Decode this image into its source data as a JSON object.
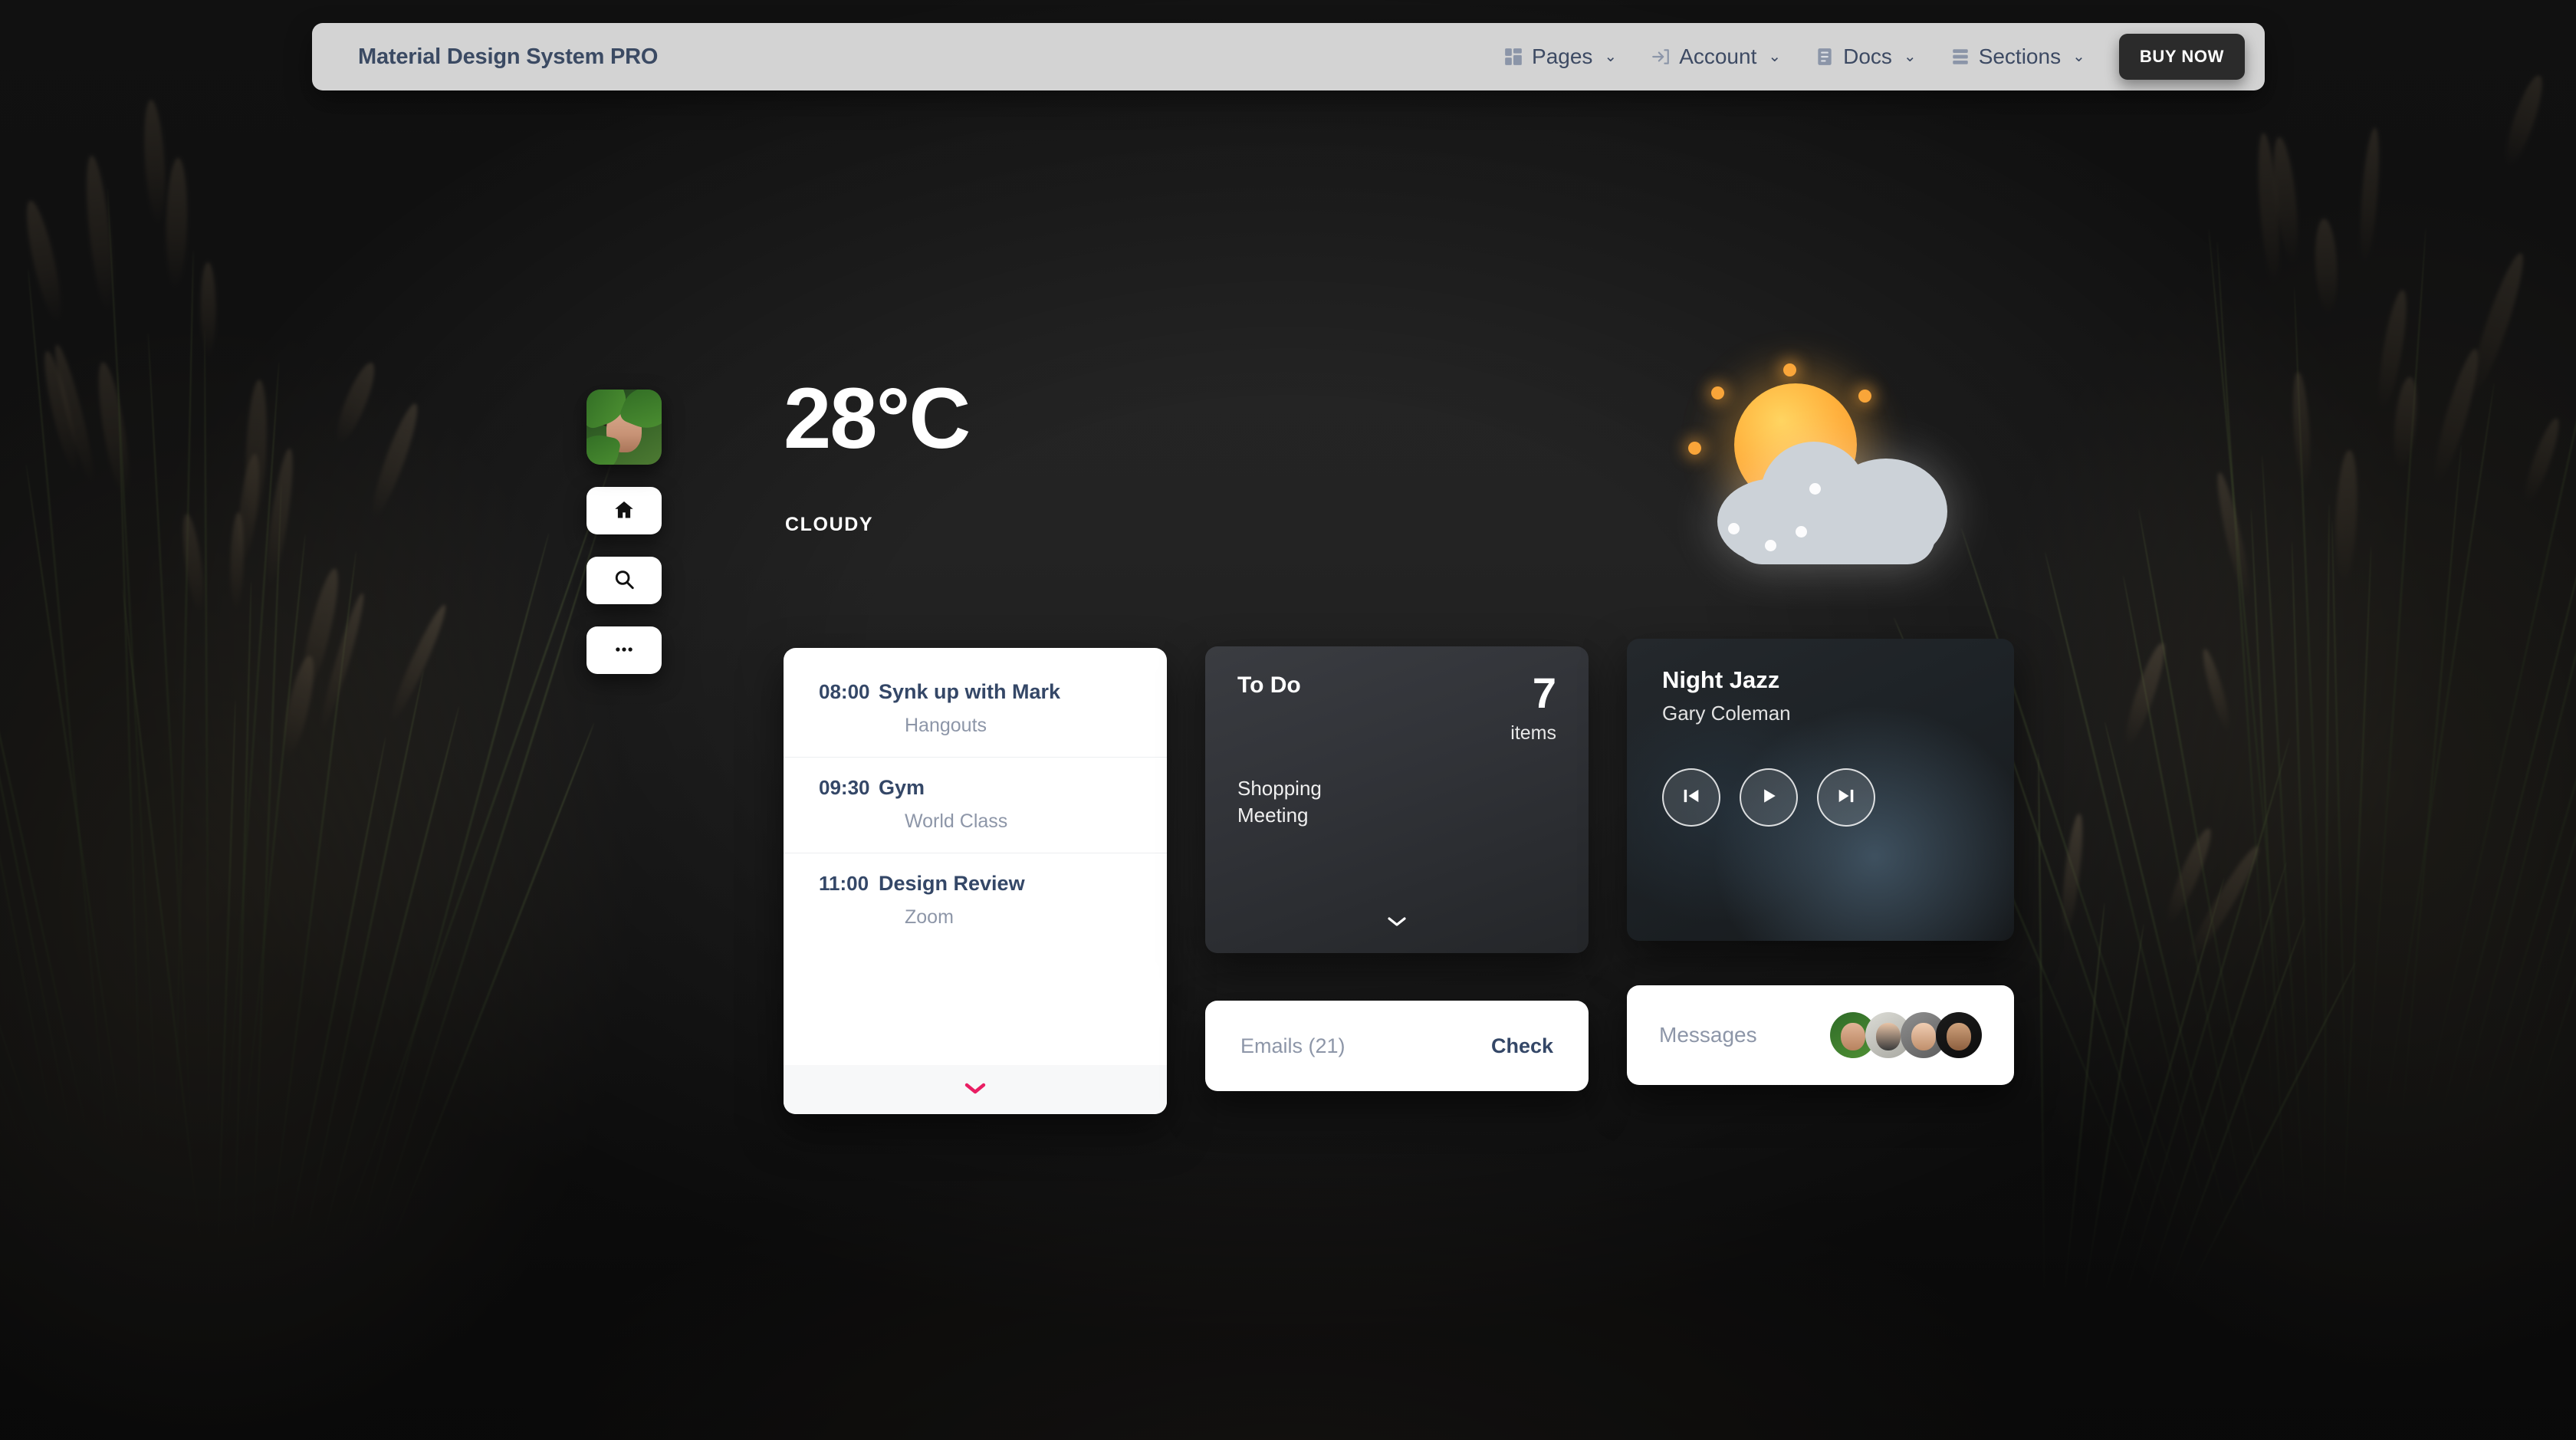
{
  "navbar": {
    "brand": "Material Design System PRO",
    "items": [
      {
        "label": "Pages",
        "icon": "dashboard-grid-icon",
        "caret": "⌄"
      },
      {
        "label": "Account",
        "icon": "login-arrow-icon",
        "caret": "⌄"
      },
      {
        "label": "Docs",
        "icon": "document-icon",
        "caret": "⌄"
      },
      {
        "label": "Sections",
        "icon": "stacked-bars-icon",
        "caret": "⌄"
      }
    ],
    "cta": "BUY NOW",
    "colors": {
      "background": "#d3d3d3",
      "text": "#3d4a63",
      "cta_bg": "#2b2b2b",
      "cta_text": "#ffffff"
    }
  },
  "rail": {
    "avatar_alt": "user-avatar",
    "buttons": [
      {
        "icon": "home-icon"
      },
      {
        "icon": "search-icon"
      },
      {
        "icon": "more-dots-icon"
      }
    ]
  },
  "weather": {
    "temperature": "28°C",
    "condition": "CLOUDY",
    "icon": "sun-behind-cloud-icon"
  },
  "schedule": {
    "rows": [
      {
        "time": "08:00",
        "title": "Synk up with Mark",
        "sub": "Hangouts"
      },
      {
        "time": "09:30",
        "title": "Gym",
        "sub": "World Class"
      },
      {
        "time": "11:00",
        "title": "Design Review",
        "sub": "Zoom"
      }
    ],
    "expand_icon": "chevron-down-icon",
    "expand_color": "#e91e63"
  },
  "todo": {
    "title": "To Do",
    "count": "7",
    "count_label": "items",
    "items": [
      "Shopping",
      "Meeting"
    ],
    "expand_icon": "chevron-down-icon"
  },
  "music": {
    "title": "Night Jazz",
    "artist": "Gary Coleman",
    "controls": [
      {
        "icon": "skip-previous-icon"
      },
      {
        "icon": "play-icon"
      },
      {
        "icon": "skip-next-icon"
      }
    ]
  },
  "emails": {
    "label": "Emails (21)",
    "action": "Check"
  },
  "messages": {
    "label": "Messages",
    "avatars": [
      "contact-1",
      "contact-2",
      "contact-3",
      "contact-4"
    ]
  }
}
